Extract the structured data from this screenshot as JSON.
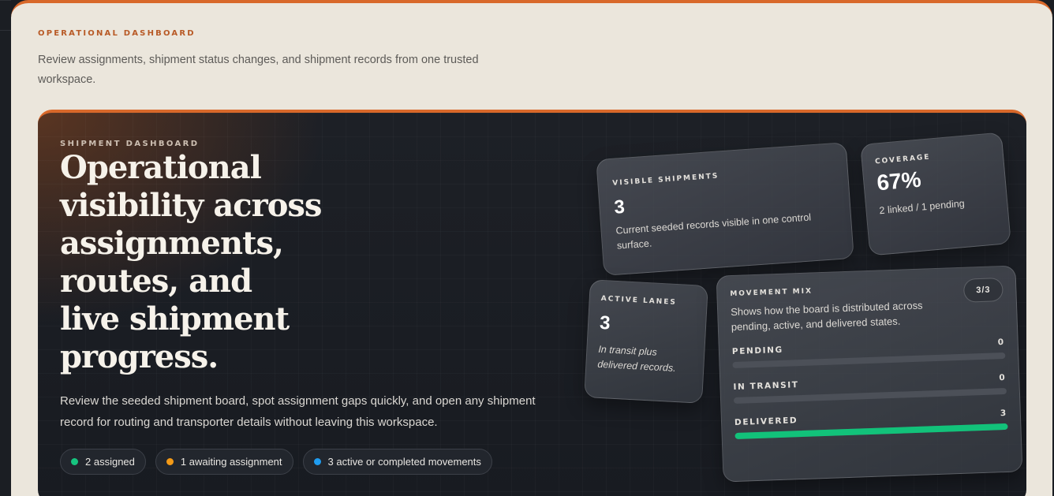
{
  "header": {
    "eyebrow": "OPERATIONAL DASHBOARD",
    "lead": "Review assignments, shipment status changes, and shipment records from one trusted workspace."
  },
  "hero": {
    "eyebrow": "SHIPMENT DASHBOARD",
    "title_lines": [
      "Operational",
      "visibility across",
      "assignments,",
      "routes, and",
      "live shipment",
      "progress."
    ],
    "body": "Review the seeded shipment board, spot assignment gaps quickly, and open any shipment record for routing and transporter details without leaving this workspace.",
    "pills": [
      {
        "label": "2 assigned",
        "color": "#16c47f"
      },
      {
        "label": "1 awaiting assignment",
        "color": "#f39a17"
      },
      {
        "label": "3 active or completed movements",
        "color": "#1f9cf0"
      }
    ]
  },
  "cards": {
    "visible": {
      "label": "VISIBLE SHIPMENTS",
      "value": "3",
      "desc": "Current seeded records visible in one control surface."
    },
    "coverage": {
      "label": "COVERAGE",
      "value": "67%",
      "desc": "2 linked / 1 pending"
    },
    "lanes": {
      "label": "ACTIVE LANES",
      "value": "3",
      "desc": "In transit plus delivered records."
    },
    "mix": {
      "label": "MOVEMENT MIX",
      "badge": "3/3",
      "desc": "Shows how the board is distributed across pending, active, and delivered states.",
      "rows": [
        {
          "label": "PENDING",
          "value": "0",
          "fraction": 0
        },
        {
          "label": "IN TRANSIT",
          "value": "0",
          "fraction": 0
        },
        {
          "label": "DELIVERED",
          "value": "3",
          "fraction": 1
        }
      ]
    }
  },
  "colors": {
    "accent": "#d8682a",
    "success": "#12c27a"
  }
}
